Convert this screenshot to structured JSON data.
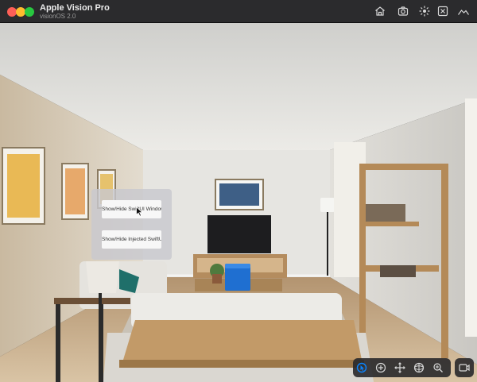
{
  "app": {
    "title": "Apple Vision Pro",
    "subtitle": "visionOS 2.0"
  },
  "toolbar": {
    "icons": [
      "home-icon",
      "camera-icon",
      "brightness-icon",
      "close-box-icon",
      "landscape-icon"
    ]
  },
  "vision_window": {
    "button1_label": "Show/Hide SwiftUI Window",
    "button2_label": "Show/Hide Injected SwiftUI"
  },
  "bottom_controls": {
    "icons": [
      "interact-icon",
      "move-icon",
      "pan-icon",
      "orbit-icon",
      "zoom-icon",
      "capture-icon"
    ]
  },
  "colors": {
    "titlebar": "#2b2b2d",
    "accent": "#0a84ff",
    "cube": "#1f6fd1"
  }
}
